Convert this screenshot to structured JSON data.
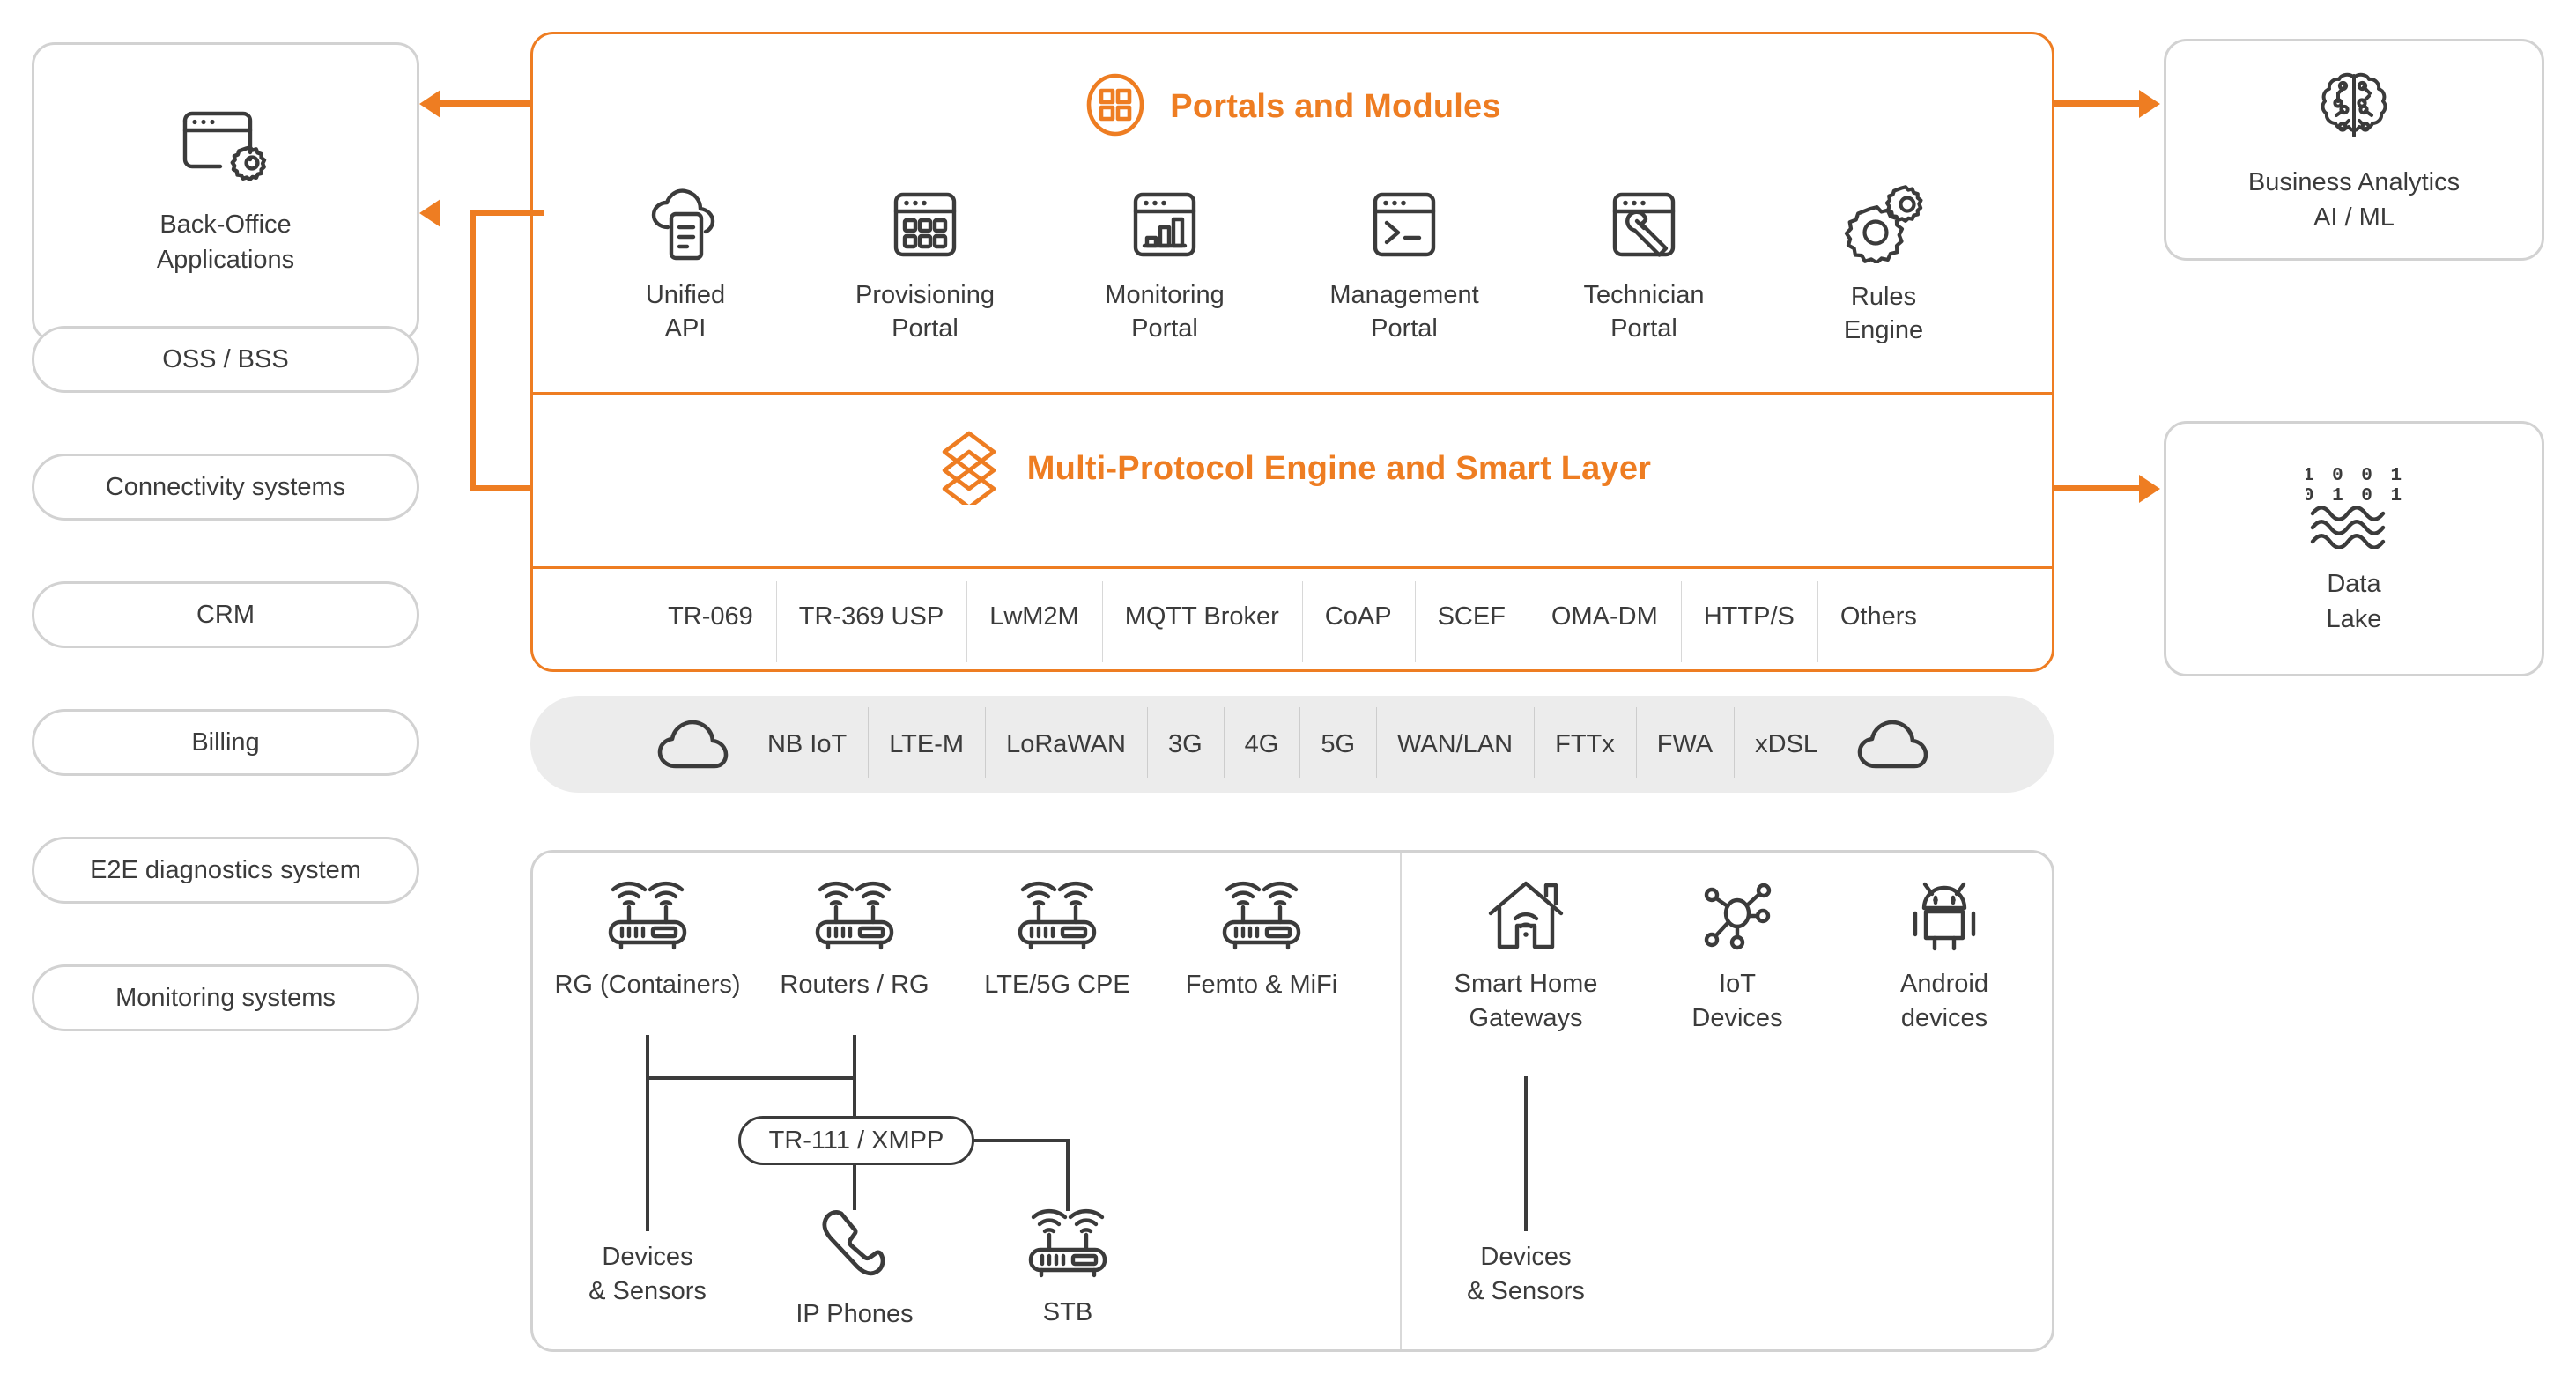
{
  "theme": {
    "accent": "#ee7d22",
    "ink": "#3b3b3b",
    "card_border": "#d2d2d2",
    "network_bar_bg": "#ececec"
  },
  "left_column": {
    "primary_card": {
      "label": "Back-Office\nApplications",
      "icon": "browser-window-gear-icon"
    },
    "items": [
      {
        "label": "OSS / BSS"
      },
      {
        "label": "Connectivity systems"
      },
      {
        "label": "CRM"
      },
      {
        "label": "Billing"
      },
      {
        "label": "E2E diagnostics system"
      },
      {
        "label": "Monitoring systems"
      }
    ]
  },
  "right_column": {
    "items": [
      {
        "label": "Business Analytics\nAI / ML",
        "icon": "brain-ai-icon"
      },
      {
        "label": "Data\nLake",
        "icon": "data-lake-binary-waves-icon",
        "binary_top": "1 0 0 1",
        "binary_bottom": "0 1 0 1"
      }
    ]
  },
  "portals_section": {
    "title": "Portals and Modules",
    "icon": "grid-four-squares-icon",
    "modules": [
      {
        "label": "Unified\nAPI",
        "icon": "cloud-document-icon"
      },
      {
        "label": "Provisioning\nPortal",
        "icon": "window-grid-icon"
      },
      {
        "label": "Monitoring\nPortal",
        "icon": "window-barchart-icon"
      },
      {
        "label": "Management\nPortal",
        "icon": "window-terminal-icon"
      },
      {
        "label": "Technician\nPortal",
        "icon": "window-wrench-icon"
      },
      {
        "label": "Rules\nEngine",
        "icon": "double-gear-icon"
      }
    ]
  },
  "protocol_section": {
    "title": "Multi-Protocol Engine and Smart Layer",
    "icon": "stacked-layers-icon",
    "protocols": [
      "TR-069",
      "TR-369 USP",
      "LwM2M",
      "MQTT Broker",
      "CoAP",
      "SCEF",
      "OMA-DM",
      "HTTP/S",
      "Others"
    ]
  },
  "network_bar": {
    "left_icon": "cloud-icon",
    "right_icon": "cloud-icon",
    "technologies": [
      "NB IoT",
      "LTE-M",
      "LoRaWAN",
      "3G",
      "4G",
      "5G",
      "WAN/LAN",
      "FTTx",
      "FWA",
      "xDSL"
    ]
  },
  "devices_panel": {
    "left_group": {
      "top_row": [
        {
          "label": "RG (Containers)",
          "icon": "router-icon"
        },
        {
          "label": "Routers / RG",
          "icon": "router-icon"
        },
        {
          "label": "LTE/5G CPE",
          "icon": "router-icon"
        },
        {
          "label": "Femto & MiFi",
          "icon": "router-icon"
        }
      ],
      "connector_badge": "TR-111 / XMPP",
      "bottom_row": [
        {
          "label": "Devices\n& Sensors",
          "icon": "none"
        },
        {
          "label": "IP Phones",
          "icon": "telephone-handset-icon"
        },
        {
          "label": "STB",
          "icon": "router-icon"
        }
      ]
    },
    "right_group": {
      "top_row": [
        {
          "label": "Smart Home\nGateways",
          "icon": "house-wifi-icon"
        },
        {
          "label": "IoT\nDevices",
          "icon": "network-nodes-icon"
        },
        {
          "label": "Android\ndevices",
          "icon": "android-robot-icon"
        }
      ],
      "bottom_row": [
        {
          "label": "Devices\n& Sensors",
          "icon": "none"
        }
      ]
    }
  }
}
